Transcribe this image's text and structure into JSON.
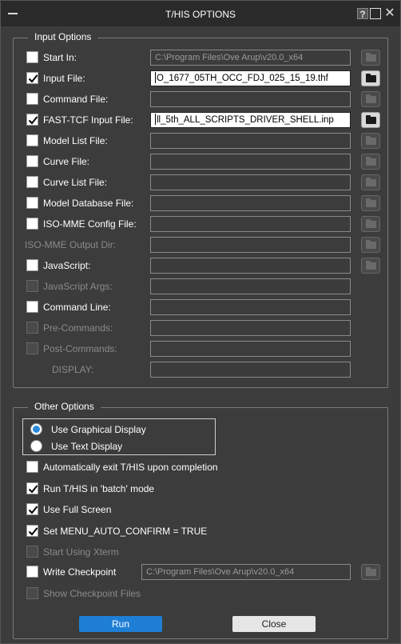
{
  "window": {
    "title": "T/HIS OPTIONS",
    "help_glyph": "?",
    "close_glyph": "✕"
  },
  "input_options": {
    "title": "Input Options",
    "rows": [
      {
        "label": "Start In:",
        "checked": false,
        "disabled": false,
        "value": "C:\\Program Files\\Ove Arup\\v20.0_x64",
        "field_active": false,
        "browse": true,
        "browse_active": false
      },
      {
        "label": "Input File:",
        "checked": true,
        "disabled": false,
        "value": "O_1677_05TH_OCC_FDJ_025_15_19.thf",
        "field_active": true,
        "browse": true,
        "browse_active": true
      },
      {
        "label": "Command File:",
        "checked": false,
        "disabled": false,
        "value": "",
        "field_active": false,
        "browse": true,
        "browse_active": false
      },
      {
        "label": "FAST-TCF Input File:",
        "checked": true,
        "disabled": false,
        "value": "ll_5th_ALL_SCRIPTS_DRIVER_SHELL.inp",
        "field_active": true,
        "browse": true,
        "browse_active": true
      },
      {
        "label": "Model List File:",
        "checked": false,
        "disabled": false,
        "value": "",
        "field_active": false,
        "browse": true,
        "browse_active": false
      },
      {
        "label": "Curve File:",
        "checked": false,
        "disabled": false,
        "value": "",
        "field_active": false,
        "browse": true,
        "browse_active": false
      },
      {
        "label": "Curve List File:",
        "checked": false,
        "disabled": false,
        "value": "",
        "field_active": false,
        "browse": true,
        "browse_active": false
      },
      {
        "label": "Model Database File:",
        "checked": false,
        "disabled": false,
        "value": "",
        "field_active": false,
        "browse": true,
        "browse_active": false
      },
      {
        "label": "ISO-MME Config File:",
        "checked": false,
        "disabled": false,
        "value": "",
        "field_active": false,
        "browse": true,
        "browse_active": false
      },
      {
        "label": "ISO-MME Output Dir:",
        "checked": null,
        "disabled": true,
        "value": "",
        "field_active": false,
        "browse": true,
        "browse_active": false
      },
      {
        "label": "JavaScript:",
        "checked": false,
        "disabled": false,
        "value": "",
        "field_active": false,
        "browse": true,
        "browse_active": false
      },
      {
        "label": "JavaScript Args:",
        "checked": false,
        "disabled": true,
        "value": "",
        "field_active": false,
        "browse": false,
        "browse_active": false
      },
      {
        "label": "Command Line:",
        "checked": false,
        "disabled": false,
        "value": "",
        "field_active": false,
        "browse": false,
        "browse_active": false
      },
      {
        "label": "Pre-Commands:",
        "checked": false,
        "disabled": true,
        "value": "",
        "field_active": false,
        "browse": false,
        "browse_active": false
      },
      {
        "label": "Post-Commands:",
        "checked": false,
        "disabled": true,
        "value": "",
        "field_active": false,
        "browse": false,
        "browse_active": false
      },
      {
        "label": "DISPLAY:",
        "checked": null,
        "disabled": true,
        "value": "",
        "field_active": false,
        "browse": false,
        "browse_active": false
      }
    ]
  },
  "other_options": {
    "title": "Other Options",
    "radios": [
      {
        "label": "Use Graphical Display",
        "selected": true
      },
      {
        "label": "Use Text Display",
        "selected": false
      }
    ],
    "checks": [
      {
        "label": "Automatically exit T/HIS upon completion",
        "checked": false,
        "disabled": false
      },
      {
        "label": "Run T/HIS in 'batch' mode",
        "checked": true,
        "disabled": false
      },
      {
        "label": "Use Full Screen",
        "checked": true,
        "disabled": false
      },
      {
        "label": "Set MENU_AUTO_CONFIRM = TRUE",
        "checked": true,
        "disabled": false
      },
      {
        "label": "Start Using Xterm",
        "checked": false,
        "disabled": true
      }
    ],
    "checkpoint": {
      "label": "Write Checkpoint",
      "checked": false,
      "value": "C:\\Program Files\\Ove Arup\\v20.0_x64"
    },
    "show_checkpoint": {
      "label": "Show Checkpoint Files",
      "checked": false,
      "disabled": true
    }
  },
  "buttons": {
    "run": "Run",
    "close": "Close"
  },
  "colors": {
    "accent": "#1f7fd6",
    "background": "#3c3c3c",
    "titlebar": "#2a2a2a"
  }
}
